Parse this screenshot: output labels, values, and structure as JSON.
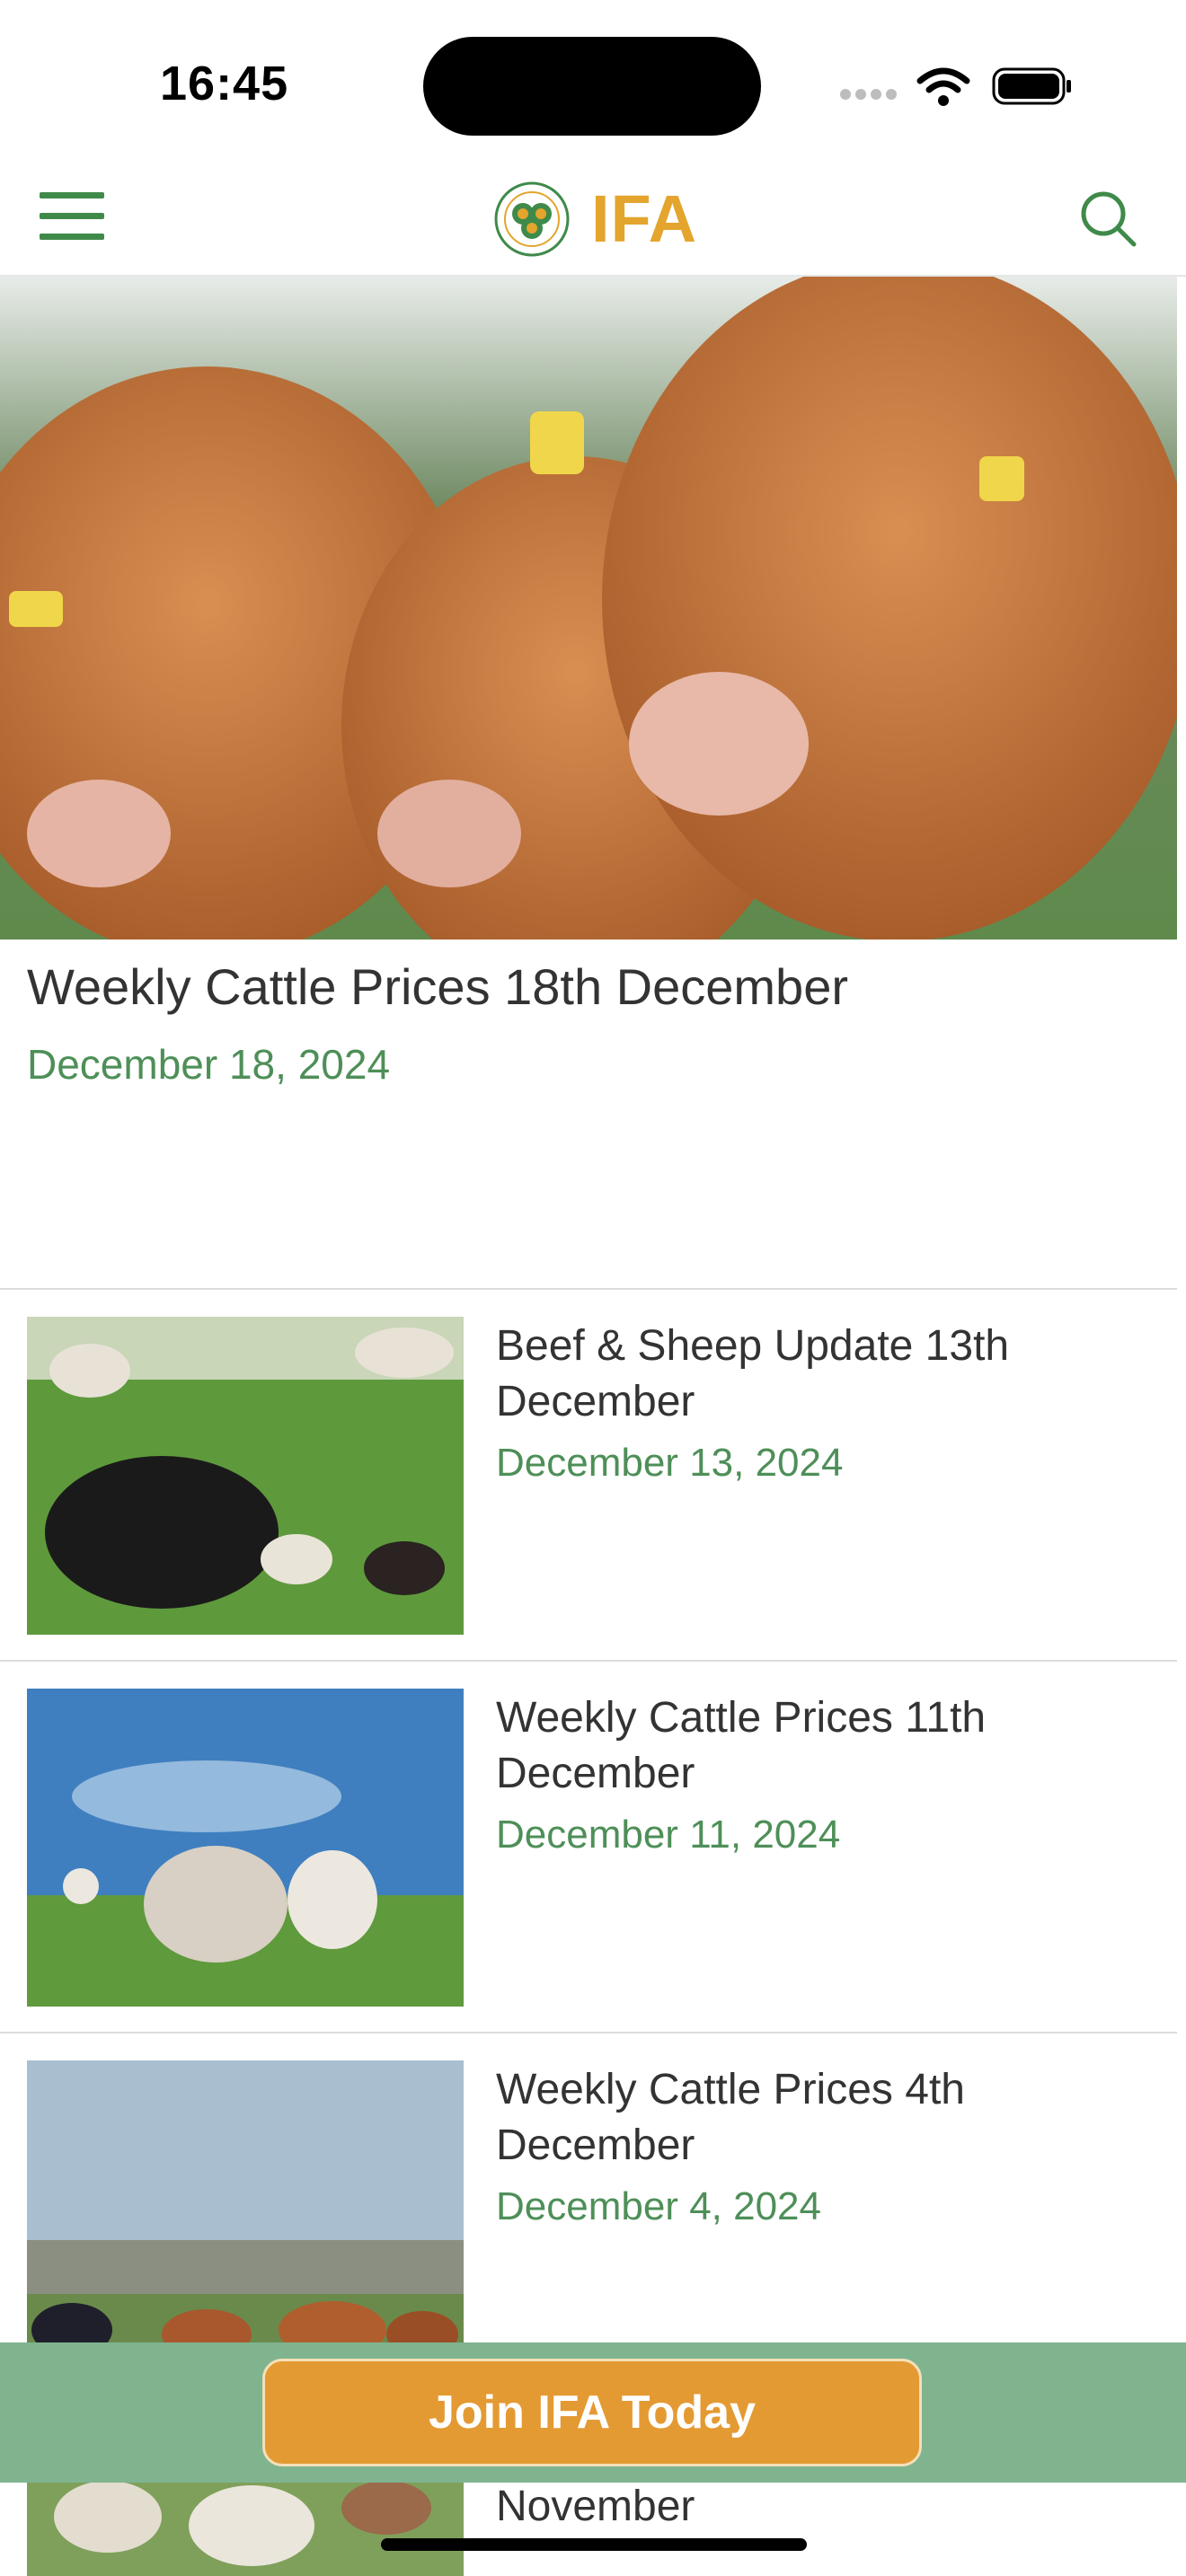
{
  "status_bar": {
    "time": "16:45"
  },
  "header": {
    "logo_text": "IFA",
    "menu_icon": "hamburger-menu-icon",
    "search_icon": "search-icon"
  },
  "hero": {
    "title": "Weekly Cattle Prices 18th December",
    "date": "December 18, 2024"
  },
  "articles": [
    {
      "title": "Beef & Sheep Update 13th December",
      "date": "December 13, 2024"
    },
    {
      "title": "Weekly Cattle Prices 11th December",
      "date": "December 11, 2024"
    },
    {
      "title": "Weekly Cattle Prices 4th December",
      "date": "December 4, 2024"
    },
    {
      "title": "November",
      "date": ""
    }
  ],
  "join": {
    "label": "Join IFA Today"
  },
  "colors": {
    "brand_green": "#3f8a4a",
    "date_green": "#4e8f58",
    "brand_gold": "#e3a52d",
    "join_bar": "#7fb48f",
    "join_button": "#e49a33"
  }
}
